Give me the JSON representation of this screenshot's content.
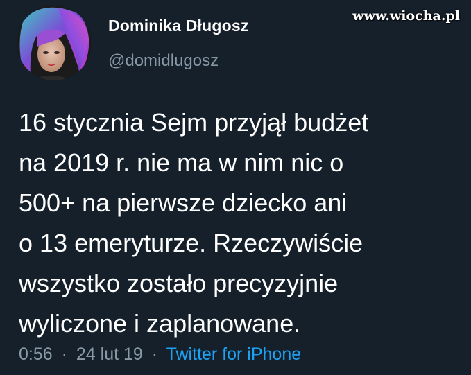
{
  "author": {
    "name": "Dominika Długosz",
    "handle": "@domidlugosz"
  },
  "watermark": "www.wiocha.pl",
  "tweet": {
    "lines": [
      "16 stycznia Sejm przyjął budżet",
      "na 2019 r. nie ma w nim nic o",
      "500+ na pierwsze dziecko ani",
      "o 13 emeryturze. Rzeczywiście",
      "wszystko zostało precyzyjnie",
      "wyliczone i zaplanowane."
    ],
    "time": "0:56",
    "date": "24 lut 19",
    "separator": "·",
    "source": "Twitter for iPhone"
  },
  "colors": {
    "background": "#15202b",
    "text": "#ffffff",
    "secondary_text": "#8899a6",
    "link": "#1da1f2"
  }
}
